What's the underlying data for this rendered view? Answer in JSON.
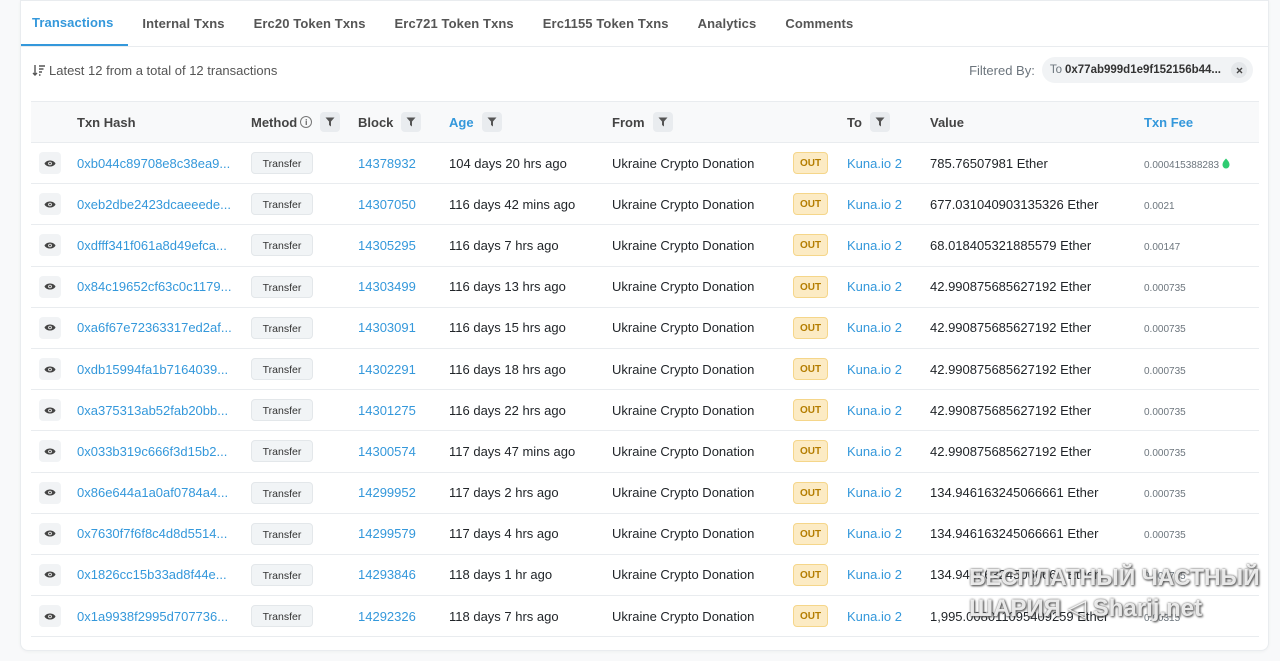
{
  "tabs": [
    {
      "label": "Transactions",
      "active": true
    },
    {
      "label": "Internal Txns"
    },
    {
      "label": "Erc20 Token Txns"
    },
    {
      "label": "Erc721 Token Txns"
    },
    {
      "label": "Erc1155 Token Txns"
    },
    {
      "label": "Analytics"
    },
    {
      "label": "Comments"
    }
  ],
  "summary": {
    "text": "Latest 12 from a total of 12 transactions",
    "filter_label": "Filtered By:",
    "filter_prefix": "To",
    "filter_value": "0x77ab999d1e9f152156b44..."
  },
  "columns": {
    "hash": "Txn Hash",
    "method": "Method",
    "block": "Block",
    "age": "Age",
    "from": "From",
    "to": "To",
    "value": "Value",
    "fee": "Txn Fee"
  },
  "colors": {
    "accent": "#3498db",
    "out_bg": "#fcebc4",
    "out_text": "#b47d00"
  },
  "rows": [
    {
      "hash": "0xb044c89708e8c38ea9...",
      "method": "Transfer",
      "block": "14378932",
      "age": "104 days 20 hrs ago",
      "from": "Ukraine Crypto Donation",
      "dir": "OUT",
      "to": "Kuna.io 2",
      "value": "785.76507981 Ether",
      "fee": "0.000415388283"
    },
    {
      "hash": "0xeb2dbe2423dcaeeede...",
      "method": "Transfer",
      "block": "14307050",
      "age": "116 days 42 mins ago",
      "from": "Ukraine Crypto Donation",
      "dir": "OUT",
      "to": "Kuna.io 2",
      "value": "677.031040903135326 Ether",
      "fee": "0.0021"
    },
    {
      "hash": "0xdfff341f061a8d49efca...",
      "method": "Transfer",
      "block": "14305295",
      "age": "116 days 7 hrs ago",
      "from": "Ukraine Crypto Donation",
      "dir": "OUT",
      "to": "Kuna.io 2",
      "value": "68.018405321885579 Ether",
      "fee": "0.00147"
    },
    {
      "hash": "0x84c19652cf63c0c1179...",
      "method": "Transfer",
      "block": "14303499",
      "age": "116 days 13 hrs ago",
      "from": "Ukraine Crypto Donation",
      "dir": "OUT",
      "to": "Kuna.io 2",
      "value": "42.990875685627192 Ether",
      "fee": "0.000735"
    },
    {
      "hash": "0xa6f67e72363317ed2af...",
      "method": "Transfer",
      "block": "14303091",
      "age": "116 days 15 hrs ago",
      "from": "Ukraine Crypto Donation",
      "dir": "OUT",
      "to": "Kuna.io 2",
      "value": "42.990875685627192 Ether",
      "fee": "0.000735"
    },
    {
      "hash": "0xdb15994fa1b7164039...",
      "method": "Transfer",
      "block": "14302291",
      "age": "116 days 18 hrs ago",
      "from": "Ukraine Crypto Donation",
      "dir": "OUT",
      "to": "Kuna.io 2",
      "value": "42.990875685627192 Ether",
      "fee": "0.000735"
    },
    {
      "hash": "0xa375313ab52fab20bb...",
      "method": "Transfer",
      "block": "14301275",
      "age": "116 days 22 hrs ago",
      "from": "Ukraine Crypto Donation",
      "dir": "OUT",
      "to": "Kuna.io 2",
      "value": "42.990875685627192 Ether",
      "fee": "0.000735"
    },
    {
      "hash": "0x033b319c666f3d15b2...",
      "method": "Transfer",
      "block": "14300574",
      "age": "117 days 47 mins ago",
      "from": "Ukraine Crypto Donation",
      "dir": "OUT",
      "to": "Kuna.io 2",
      "value": "42.990875685627192 Ether",
      "fee": "0.000735"
    },
    {
      "hash": "0x86e644a1a0af0784a4...",
      "method": "Transfer",
      "block": "14299952",
      "age": "117 days 2 hrs ago",
      "from": "Ukraine Crypto Donation",
      "dir": "OUT",
      "to": "Kuna.io 2",
      "value": "134.946163245066661 Ether",
      "fee": "0.000735"
    },
    {
      "hash": "0x7630f7f6f8c4d8d5514...",
      "method": "Transfer",
      "block": "14299579",
      "age": "117 days 4 hrs ago",
      "from": "Ukraine Crypto Donation",
      "dir": "OUT",
      "to": "Kuna.io 2",
      "value": "134.946163245066661 Ether",
      "fee": "0.000735"
    },
    {
      "hash": "0x1826cc15b33ad8f44e...",
      "method": "Transfer",
      "block": "14293846",
      "age": "118 days 1 hr ago",
      "from": "Ukraine Crypto Donation",
      "dir": "OUT",
      "to": "Kuna.io 2",
      "value": "134.946163245066661 Ether",
      "fee": "0.000735"
    },
    {
      "hash": "0x1a9938f2995d707736...",
      "method": "Transfer",
      "block": "14292326",
      "age": "118 days 7 hrs ago",
      "from": "Ukraine Crypto Donation",
      "dir": "OUT",
      "to": "Kuna.io 2",
      "value": "1,995.008011095409259 Ether",
      "fee": "0.00315"
    }
  ],
  "watermark": {
    "line1": "БЕСПЛАТНЫЙ ЧАСТНЫЙ",
    "line2": "ШАРИЯ ◁ Sharij.net"
  }
}
